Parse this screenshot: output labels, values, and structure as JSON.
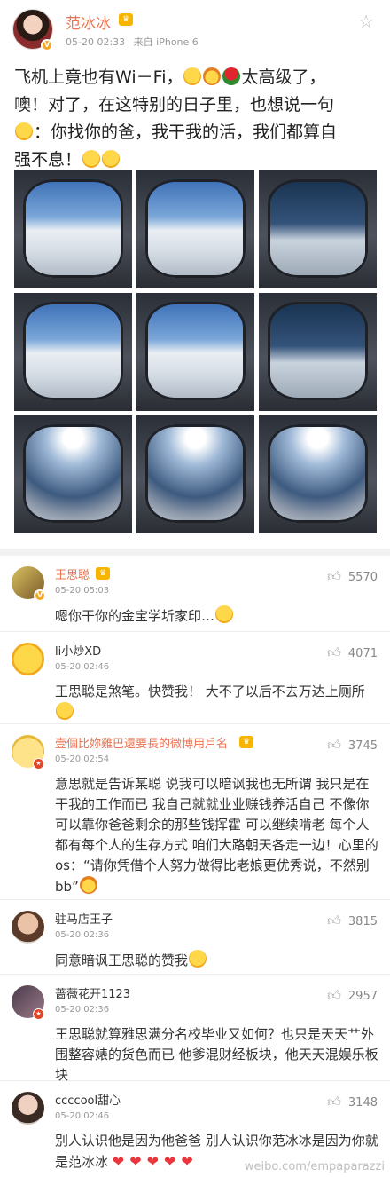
{
  "post": {
    "author": "范冰冰",
    "time": "05-20 02:33",
    "source": "来自 iPhone 6",
    "text_line1": "飞机上竟也有Wi－Fi，",
    "text_line1b": "太高级了，",
    "text_line2": "噢！对了，在这特别的日子里，也想说一句",
    "text_line3": "：你找你的爸，我干我的活，我们都算自",
    "text_line4": "强不息！",
    "images": [
      "window",
      "window",
      "window",
      "window",
      "window",
      "window",
      "sun",
      "sun",
      "sun"
    ]
  },
  "comments": [
    {
      "name": "王思聪",
      "time": "05-20 05:03",
      "likes": "5570",
      "text": "嗯你干你的金宝学圻家印…"
    },
    {
      "name": "li小炒XD",
      "time": "05-20 02:46",
      "likes": "4071",
      "text": "王思聪是煞笔。快赞我！ 大不了以后不去万达上厕所"
    },
    {
      "name": "壹個比妳雞巴還要長的微博用戶名",
      "time": "05-20 02:54",
      "likes": "3745",
      "text": "意思就是告诉某聪 说我可以暗讽我也无所谓 我只是在干我的工作而已 我自己就就业业赚钱养活自己 不像你可以靠你爸爸剩余的那些钱挥霍 可以继续啃老 每个人都有每个人的生存方式 咱们大路朝天各走一边！心里的os：“请你凭借个人努力做得比老娘更优秀说，不然别bb”"
    },
    {
      "name": "驻马店王子",
      "time": "05-20 02:36",
      "likes": "3815",
      "text": "同意暗讽王思聪的赞我"
    },
    {
      "name": "蔷薇花开1123",
      "time": "05-20 02:36",
      "likes": "2957",
      "text": "王思聪就算雅思满分名校毕业又如何？也只是天天艹外围整容婊的货色而已 他爹混财经板块，他天天混娱乐板块"
    },
    {
      "name": "ccccool甜心",
      "time": "05-20 02:46",
      "likes": "3148",
      "text": "别人认识他是因为他爸爸 别人认识你范冰冰是因为你就是范冰冰"
    }
  ],
  "watermark": "weibo.com/empaparazzi",
  "colors": {
    "accent": "#eb7350",
    "heart": "#e8363c"
  },
  "icons": {
    "favorite": "star-outline",
    "like": "thumb-up"
  }
}
